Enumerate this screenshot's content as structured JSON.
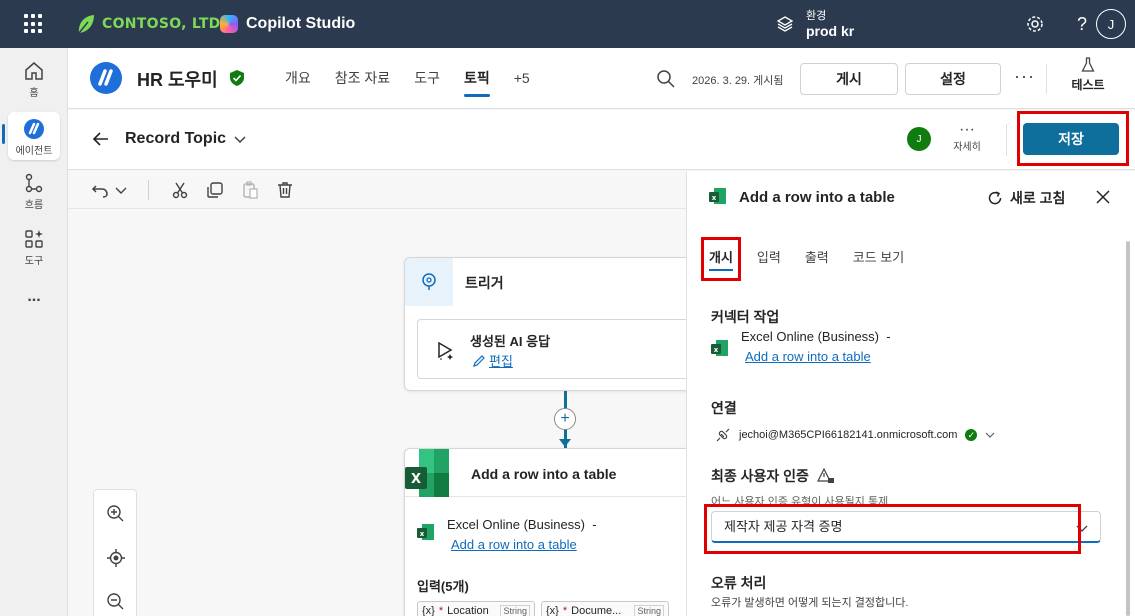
{
  "topbar": {
    "brand": "CONTOSO, LTD.",
    "product": "Copilot Studio",
    "env_label": "환경",
    "env_value": "prod kr",
    "avatar": "J"
  },
  "rail": {
    "home": "홈",
    "agents": "에이전트",
    "flows": "흐름",
    "tools": "도구",
    "more": "..."
  },
  "agent": {
    "name": "HR 도우미",
    "tabs": [
      "개요",
      "참조 자료",
      "도구",
      "토픽",
      "+5"
    ],
    "active_tab": "토픽",
    "published": "2026. 3. 29. 게시됨",
    "publish_btn": "게시",
    "settings_btn": "설정",
    "more": "···",
    "test_btn": "테스트"
  },
  "topic": {
    "name": "Record Topic",
    "user_badge": "J",
    "details": "자세히",
    "save": "저장"
  },
  "canvas": {
    "trigger_title": "트리거",
    "gen_ai_title": "생성된 AI 응답",
    "edit": "편집",
    "plus": "+",
    "action_title": "Add a row into a table",
    "connector_name": "Excel Online (Business)",
    "connector_dash": "-",
    "action_link": "Add a row into a table",
    "inputs_label": "입력(5개)",
    "chips": [
      {
        "name": "Location",
        "type": "String"
      },
      {
        "name": "Docume...",
        "type": "String"
      }
    ],
    "chip_var": "{x}",
    "chip_req": "*"
  },
  "panel": {
    "title": "Add a row into a table",
    "refresh": "새로 고침",
    "tabs": [
      "개시",
      "입력",
      "출력",
      "코드 보기"
    ],
    "active_tab": "개시",
    "connector_action_title": "커넥터 작업",
    "connector_name": "Excel Online (Business)",
    "connector_dash": "-",
    "connector_link": "Add a row into a table",
    "connection_title": "연결",
    "connection_account": "jechoi@M365CPI66182141.onmicrosoft.com",
    "auth_title": "최종 사용자 인증",
    "auth_desc": "어느 사용자 인증 유형이 사용될지 통제",
    "auth_value": "제작자 제공 자격 증명",
    "error_title": "오류 처리",
    "error_desc": "오류가 발생하면 어떻게 되는지 결정합니다."
  },
  "colors": {
    "topbar": "#2b3a4e",
    "accent": "#0f6cbd",
    "save": "#0f6f9c",
    "highlight": "#e00000",
    "brand_green": "#7ed957"
  }
}
